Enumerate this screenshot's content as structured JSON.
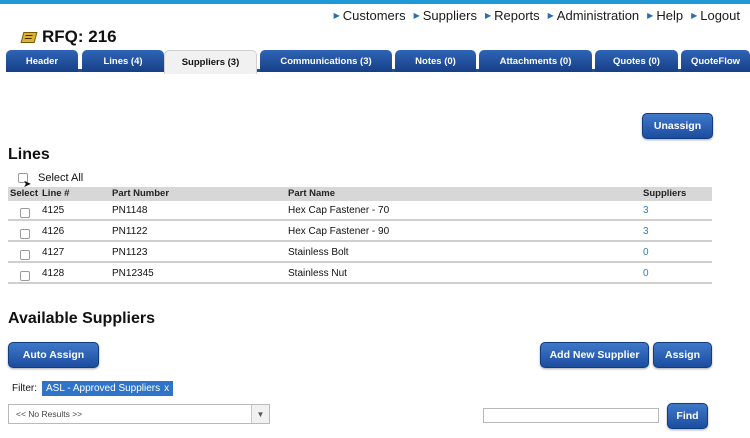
{
  "topnav": {
    "items": [
      "Customers",
      "Suppliers",
      "Reports",
      "Administration",
      "Help",
      "Logout"
    ]
  },
  "page": {
    "title": "RFQ: 216"
  },
  "tabs": [
    {
      "label": "Header"
    },
    {
      "label": "Lines (4)"
    },
    {
      "label": "Suppliers (3)",
      "active": true
    },
    {
      "label": "Communications (3)"
    },
    {
      "label": "Notes (0)"
    },
    {
      "label": "Attachments (0)"
    },
    {
      "label": "Quotes (0)"
    },
    {
      "label": "QuoteFlow"
    }
  ],
  "actions": {
    "unassign_label": "Unassign"
  },
  "lines": {
    "title": "Lines",
    "select_all_label": "Select All",
    "columns": [
      "Select",
      "Line #",
      "Part Number",
      "Part Name",
      "Suppliers"
    ],
    "rows": [
      {
        "line": "4125",
        "part_number": "PN1148",
        "part_name": "Hex Cap Fastener - 70",
        "suppliers": "3"
      },
      {
        "line": "4126",
        "part_number": "PN1122",
        "part_name": "Hex Cap Fastener - 90",
        "suppliers": "3"
      },
      {
        "line": "4127",
        "part_number": "PN1123",
        "part_name": "Stainless Bolt",
        "suppliers": "0"
      },
      {
        "line": "4128",
        "part_number": "PN12345",
        "part_name": "Stainless Nut",
        "suppliers": "0"
      }
    ]
  },
  "available_suppliers": {
    "title": "Available Suppliers",
    "auto_assign_label": "Auto Assign",
    "add_new_supplier_label": "Add New Supplier",
    "assign_label": "Assign",
    "filter_label": "Filter:",
    "filter_chip": "ASL - Approved Suppliers",
    "filter_remove": "x",
    "dropdown_value": "<< No Results >>",
    "find_label": "Find"
  },
  "colors": {
    "accent": "#1c4d9f",
    "link": "#2c7ec4",
    "chip": "#2e74c8",
    "stripe": "#1f9ad6"
  },
  "icons": {
    "title_icon": "tag-icon",
    "nav_arrow": "triangle-right-icon",
    "dropdown": "chevron-down-icon"
  }
}
